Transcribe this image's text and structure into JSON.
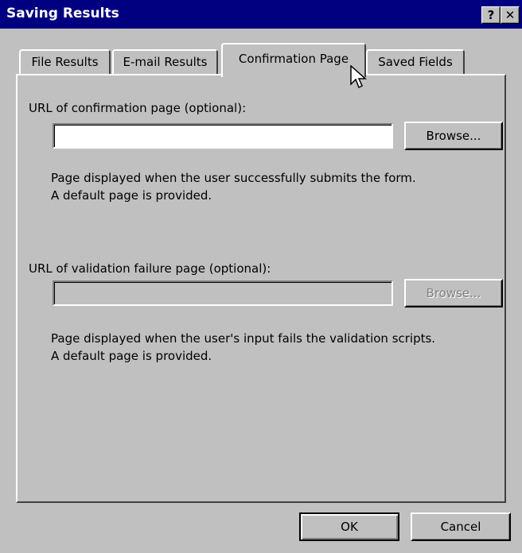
{
  "window": {
    "title": "Saving Results",
    "help_glyph": "?",
    "close_glyph": "✕"
  },
  "tabs": [
    {
      "label": "File Results"
    },
    {
      "label": "E-mail Results"
    },
    {
      "label": "Confirmation Page",
      "selected": true
    },
    {
      "label": "Saved Fields"
    }
  ],
  "confirmation": {
    "label": "URL of confirmation page (optional):",
    "value": "",
    "browse_label": "Browse...",
    "description_line1": "Page displayed when the user successfully submits the form.",
    "description_line2": "A default page is provided."
  },
  "validation": {
    "label": "URL of validation failure page (optional):",
    "value": "",
    "browse_label": "Browse...",
    "enabled": false,
    "description_line1": "Page displayed when the user's input fails the validation scripts.",
    "description_line2": "A default page is provided."
  },
  "footer": {
    "ok_label": "OK",
    "cancel_label": "Cancel"
  },
  "colors": {
    "titlebar": "#000080",
    "face": "#c0c0c0"
  }
}
